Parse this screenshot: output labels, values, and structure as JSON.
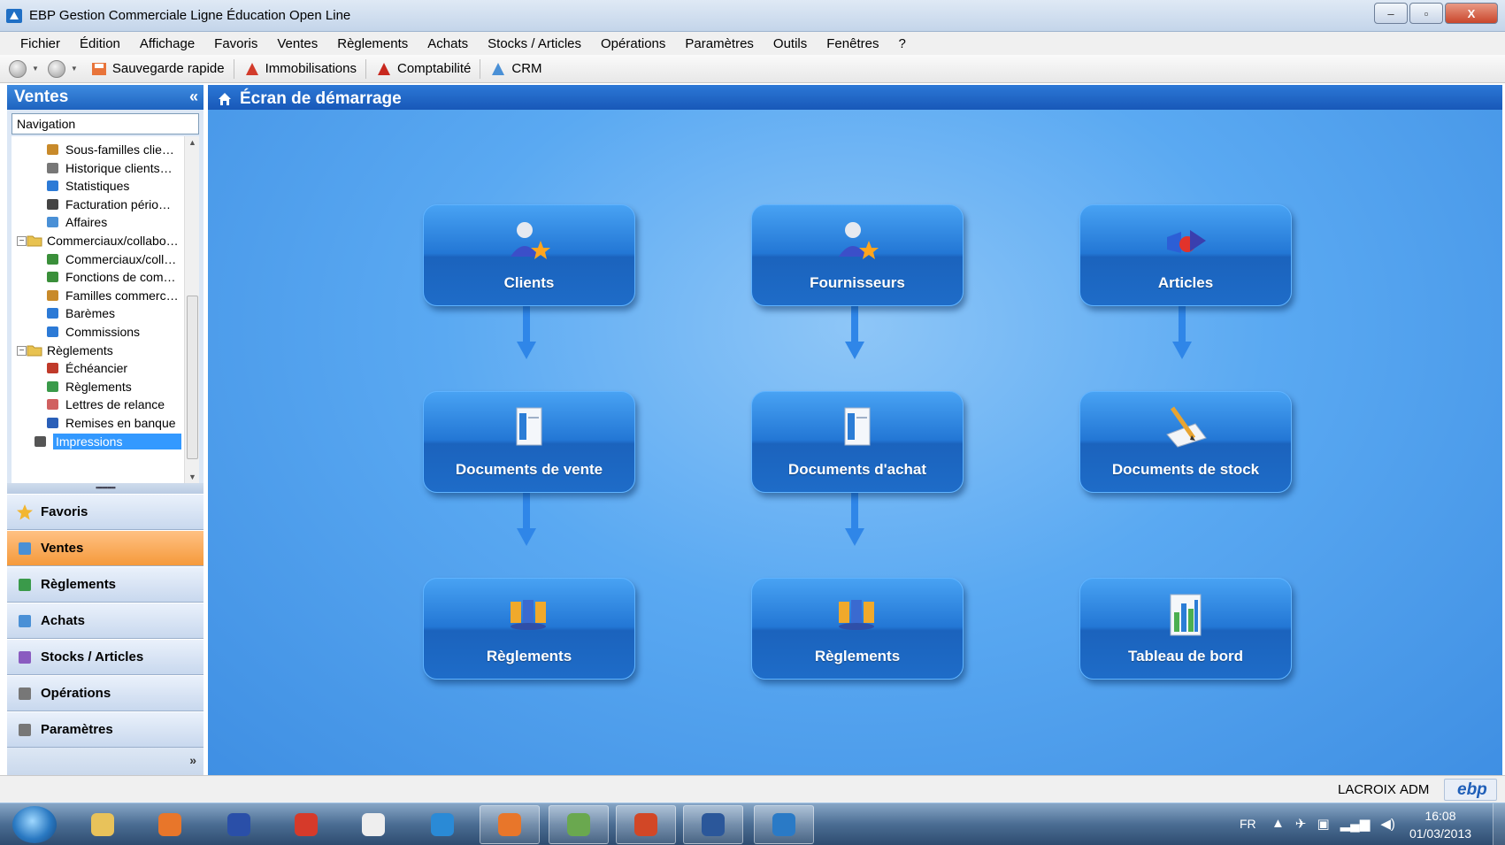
{
  "window": {
    "title": "EBP Gestion Commerciale Ligne Éducation Open Line",
    "controls": {
      "minimize": "–",
      "maximize": "▫",
      "close": "X"
    }
  },
  "menu": [
    "Fichier",
    "Édition",
    "Affichage",
    "Favoris",
    "Ventes",
    "Règlements",
    "Achats",
    "Stocks / Articles",
    "Opérations",
    "Paramètres",
    "Outils",
    "Fenêtres",
    "?"
  ],
  "toolbar": {
    "quick_save": "Sauvegarde rapide",
    "assets": "Immobilisations",
    "accounting": "Comptabilité",
    "crm": "CRM"
  },
  "sidebar": {
    "title": "Ventes",
    "collapse_glyph": "«",
    "nav_select": "Navigation",
    "tree": [
      {
        "label": "Sous-familles clie…",
        "icon": "users-icon"
      },
      {
        "label": "Historique clients…",
        "icon": "history-icon"
      },
      {
        "label": "Statistiques",
        "icon": "chart-icon"
      },
      {
        "label": "Facturation pério…",
        "icon": "clock-icon"
      },
      {
        "label": "Affaires",
        "icon": "briefcase-icon"
      },
      {
        "label": "Commerciaux/collabo…",
        "icon": "folder-icon"
      },
      {
        "label": "Commerciaux/coll…",
        "icon": "user-icon"
      },
      {
        "label": "Fonctions de com…",
        "icon": "user-icon"
      },
      {
        "label": "Familles commerc…",
        "icon": "users-icon"
      },
      {
        "label": "Barèmes",
        "icon": "chart-icon"
      },
      {
        "label": "Commissions",
        "icon": "chart-icon"
      },
      {
        "label": "Règlements",
        "icon": "folder-icon"
      },
      {
        "label": "Échéancier",
        "icon": "calendar-icon"
      },
      {
        "label": "Règlements",
        "icon": "money-icon"
      },
      {
        "label": "Lettres de relance",
        "icon": "letters-icon"
      },
      {
        "label": "Remises en banque",
        "icon": "bank-icon"
      },
      {
        "label": "Impressions",
        "icon": "printer-icon"
      }
    ],
    "nav_buttons": [
      {
        "label": "Favoris",
        "icon": "star-icon"
      },
      {
        "label": "Ventes",
        "icon": "sales-icon"
      },
      {
        "label": "Règlements",
        "icon": "money-icon"
      },
      {
        "label": "Achats",
        "icon": "purchase-icon"
      },
      {
        "label": "Stocks / Articles",
        "icon": "stock-icon"
      },
      {
        "label": "Opérations",
        "icon": "operations-icon"
      },
      {
        "label": "Paramètres",
        "icon": "settings-icon"
      }
    ],
    "footer_glyph": "»"
  },
  "main": {
    "title": "Écran de démarrage",
    "tiles": [
      {
        "label": "Clients",
        "icon": "client-star-icon"
      },
      {
        "label": "Fournisseurs",
        "icon": "supplier-star-icon"
      },
      {
        "label": "Articles",
        "icon": "articles-icon"
      },
      {
        "label": "Documents de vente",
        "icon": "document-icon"
      },
      {
        "label": "Documents d'achat",
        "icon": "document-icon"
      },
      {
        "label": "Documents de stock",
        "icon": "stock-document-icon"
      },
      {
        "label": "Règlements",
        "icon": "payments-icon"
      },
      {
        "label": "Règlements",
        "icon": "payments-icon"
      },
      {
        "label": "Tableau de bord",
        "icon": "dashboard-icon"
      }
    ]
  },
  "status": {
    "user": "LACROIX",
    "role": "ADM",
    "logo": "ebp"
  },
  "taskbar": {
    "apps": [
      "explorer-icon",
      "media-player-icon",
      "contacts-icon",
      "pin-icon",
      "clock-app-icon",
      "internet-explorer-icon",
      "firefox-icon",
      "recycle-icon",
      "powerpoint-icon",
      "word-icon",
      "ebp-icon"
    ],
    "lang": "FR",
    "time": "16:08",
    "date": "01/03/2013"
  },
  "colors": {
    "accent": "#2377d5",
    "active_nav": "#f59a3b",
    "background": "#5aa9f2"
  }
}
